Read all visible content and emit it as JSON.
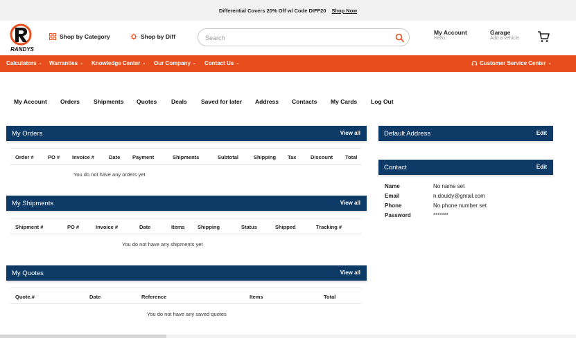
{
  "promo": {
    "text": "Differential Covers 20% Off w/ Code DIFF20",
    "link": "Shop Now"
  },
  "header": {
    "logo_text": "RANDYS",
    "shop_by_category": "Shop by Category",
    "shop_by_diff": "Shop by Diff",
    "search_placeholder": "Search",
    "my_account": "My Account",
    "my_account_sub": "Hello,",
    "garage": "Garage",
    "garage_sub": "Add a vehicle",
    "brand_color": "#e84e1b"
  },
  "nav": {
    "items": [
      "Calculators",
      "Warranties",
      "Knowledge Center",
      "Our Company",
      "Contact Us"
    ],
    "customer_service": "Customer Service Center"
  },
  "account_tabs": [
    "My Account",
    "Orders",
    "Shipments",
    "Quotes",
    "Deals",
    "Saved for later",
    "Address",
    "Contacts",
    "My Cards",
    "Log Out"
  ],
  "orders": {
    "title": "My Orders",
    "action": "View all",
    "columns": [
      "Order #",
      "PO #",
      "Invoice #",
      "Date",
      "Payment",
      "Shipments",
      "Subtotal",
      "Shipping",
      "Tax",
      "Discount",
      "Total"
    ],
    "empty": "You do not have any orders yet"
  },
  "shipments": {
    "title": "My Shipments",
    "action": "View all",
    "columns": [
      "Shipment #",
      "PO #",
      "Invoice #",
      "Date",
      "Items",
      "Shipping",
      "Status",
      "Shipped",
      "Tracking #"
    ],
    "empty": "You do not have any shipments yet"
  },
  "quotes": {
    "title": "My Quotes",
    "action": "View all",
    "columns": [
      "Quote.#",
      "Date",
      "Reference",
      "Items",
      "Total"
    ],
    "empty": "You do not have any saved quotes"
  },
  "default_address": {
    "title": "Default Address",
    "action": "Edit"
  },
  "contact": {
    "title": "Contact",
    "action": "Edit",
    "rows": [
      {
        "label": "Name",
        "value": "No name set"
      },
      {
        "label": "Email",
        "value": "n.douidy@gmail.com"
      },
      {
        "label": "Phone",
        "value": "No phone number set"
      },
      {
        "label": "Password",
        "value": "*******"
      }
    ]
  },
  "panel_color": "#0d3a66"
}
